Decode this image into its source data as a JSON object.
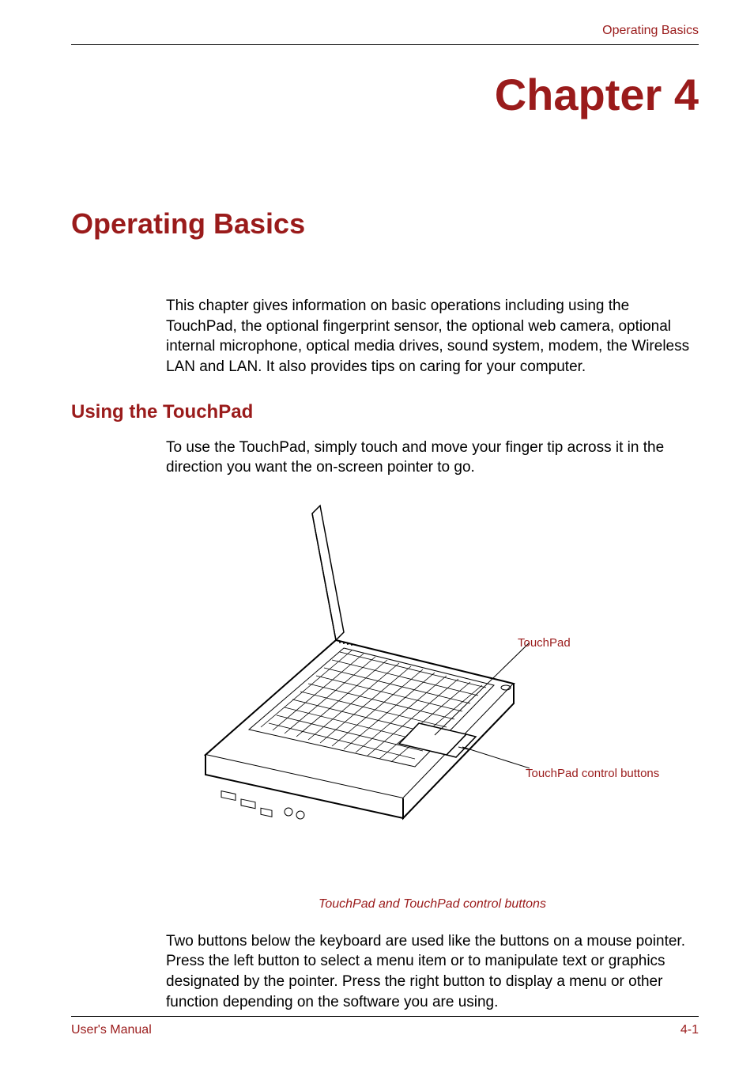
{
  "header": {
    "label": "Operating Basics"
  },
  "chapter": {
    "title": "Chapter 4"
  },
  "section": {
    "title": "Operating Basics",
    "intro": "This chapter gives information on basic operations including using the TouchPad, the optional fingerprint sensor, the optional web camera, optional internal microphone, optical media drives, sound system, modem, the Wireless LAN and LAN. It also provides tips on caring for your computer."
  },
  "subsection": {
    "title": "Using the TouchPad",
    "intro": "To use the TouchPad, simply touch and move your finger tip across it in the direction you want the on-screen pointer to go.",
    "figure": {
      "callouts": {
        "touchpad": "TouchPad",
        "buttons": "TouchPad control buttons"
      },
      "caption": "TouchPad and TouchPad control buttons"
    },
    "body2": "Two buttons below the keyboard are used like the buttons on a mouse pointer. Press the left button to select a menu item or to manipulate text or graphics designated by the pointer. Press the right button to display a menu or other function depending on the software you are using."
  },
  "footer": {
    "left": "User's Manual",
    "right": "4-1"
  }
}
